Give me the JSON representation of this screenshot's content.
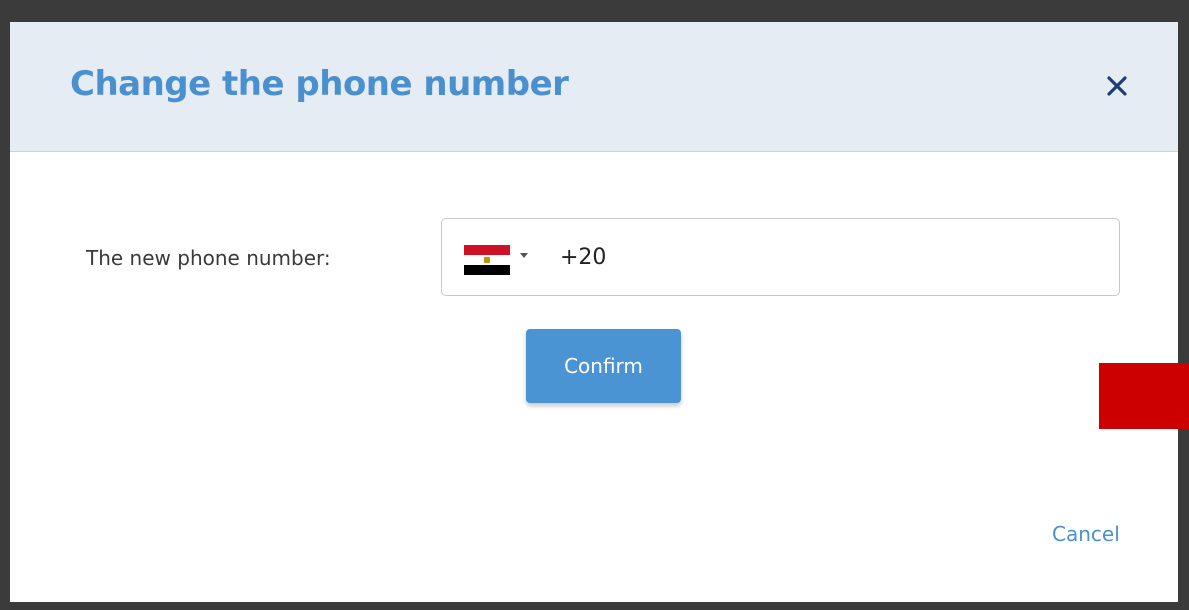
{
  "dialog": {
    "title": "Change the phone number",
    "close_icon": "close-icon"
  },
  "form": {
    "phone_label": "The new phone number:",
    "country": {
      "flag_icon": "egypt-flag-icon",
      "dropdown_icon": "caret-down-icon",
      "selected": "Egypt"
    },
    "phone_value": "+20"
  },
  "actions": {
    "confirm_label": "Confirm",
    "cancel_label": "Cancel"
  },
  "colors": {
    "accent": "#4a90cf",
    "button": "#4a94d4",
    "header_bg": "#e6ecf3",
    "marker": "#cc0000"
  }
}
